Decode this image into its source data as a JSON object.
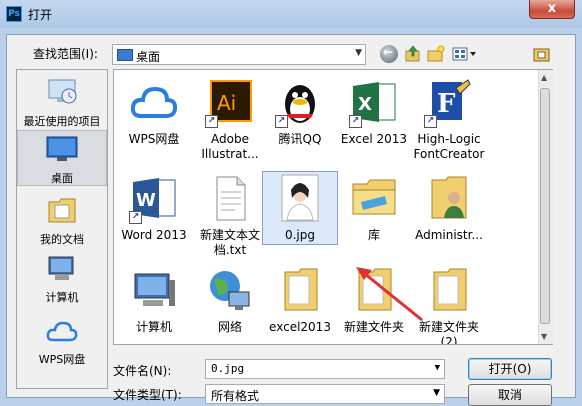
{
  "window": {
    "app_icon": "Ps",
    "title": "打开",
    "close_label": "x"
  },
  "toolbar": {
    "lookin_label": "查找范围(I):",
    "lookin_value": "桌面"
  },
  "sidebar": {
    "items": [
      {
        "label": "最近使用的项目",
        "icon": "recent-places-icon"
      },
      {
        "label": "桌面",
        "icon": "desktop-icon",
        "selected": true
      },
      {
        "label": "我的文档",
        "icon": "documents-folder-icon"
      },
      {
        "label": "计算机",
        "icon": "computer-icon"
      },
      {
        "label": "WPS网盘",
        "icon": "wps-cloud-icon"
      }
    ]
  },
  "files": [
    {
      "label": "WPS网盘",
      "icon": "wps-cloud-icon"
    },
    {
      "label": "Adobe Illustrat...",
      "icon": "illustrator-icon",
      "shortcut": true
    },
    {
      "label": "腾讯QQ",
      "icon": "qq-penguin-icon",
      "shortcut": true
    },
    {
      "label": "Excel 2013",
      "icon": "excel-icon",
      "shortcut": true
    },
    {
      "label": "High-Logic FontCreator",
      "icon": "fontcreator-icon",
      "shortcut": true
    },
    {
      "label": "Word 2013",
      "icon": "word-icon",
      "shortcut": true
    },
    {
      "label": "新建文本文档.txt",
      "icon": "text-file-icon"
    },
    {
      "label": "0.jpg",
      "icon": "photo-thumbnail-icon",
      "selected": true
    },
    {
      "label": "库",
      "icon": "library-folder-icon"
    },
    {
      "label": "Administr...",
      "icon": "user-folder-icon"
    },
    {
      "label": "计算机",
      "icon": "computer-icon"
    },
    {
      "label": "网络",
      "icon": "network-globe-icon"
    },
    {
      "label": "excel2013",
      "icon": "folder-icon"
    },
    {
      "label": "新建文件夹",
      "icon": "folder-icon"
    },
    {
      "label": "新建文件夹 (2)",
      "icon": "folder-icon"
    }
  ],
  "bottom": {
    "filename_label": "文件名(N):",
    "filename_value": "0.jpg",
    "filetype_label": "文件类型(T):",
    "filetype_value": "所有格式",
    "open_label": "打开(O)",
    "cancel_label": "取消"
  },
  "colors": {
    "annotation_arrow": "#e03030",
    "selection": "#dbe9fb"
  }
}
